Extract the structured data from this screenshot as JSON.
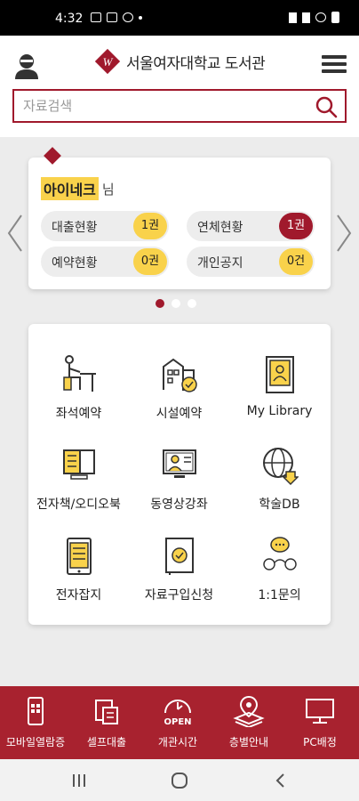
{
  "status_bar": {
    "time": "4:32"
  },
  "header": {
    "logo_title": "서울여자대학교 도서관",
    "search_placeholder": "자료검색"
  },
  "user_card": {
    "username": "아이네크",
    "username_suffix": "님",
    "stats": [
      {
        "label": "대출현황",
        "value": "1권",
        "highlight": "yellow"
      },
      {
        "label": "연체현황",
        "value": "1권",
        "highlight": "red"
      },
      {
        "label": "예약현황",
        "value": "0권",
        "highlight": "yellow"
      },
      {
        "label": "개인공지",
        "value": "0건",
        "highlight": "yellow"
      }
    ],
    "carousel_pages": 3,
    "active_page": 1
  },
  "menu": {
    "tiles": [
      {
        "label": "좌석예약",
        "icon": "seat-icon"
      },
      {
        "label": "시설예약",
        "icon": "facility-icon"
      },
      {
        "label": "My Library",
        "icon": "my-library-icon"
      },
      {
        "label": "전자책/오디오북",
        "icon": "ebook-icon"
      },
      {
        "label": "동영상강좌",
        "icon": "video-lecture-icon"
      },
      {
        "label": "학술DB",
        "icon": "globe-icon"
      },
      {
        "label": "전자잡지",
        "icon": "tablet-icon"
      },
      {
        "label": "자료구입신청",
        "icon": "book-request-icon"
      },
      {
        "label": "1:1문의",
        "icon": "chat-icon"
      }
    ]
  },
  "bottom_nav": {
    "items": [
      {
        "label": "모바일열람증",
        "icon": "mobile-card-icon"
      },
      {
        "label": "셀프대출",
        "icon": "self-checkout-icon"
      },
      {
        "label": "개관시간",
        "icon": "open-hours-icon",
        "icon_text": "OPEN"
      },
      {
        "label": "층별안내",
        "icon": "floor-guide-icon"
      },
      {
        "label": "PC배정",
        "icon": "pc-icon"
      }
    ]
  },
  "colors": {
    "brand_red": "#a0192c",
    "nav_red": "#a8222f",
    "accent_yellow": "#f9d24b"
  }
}
